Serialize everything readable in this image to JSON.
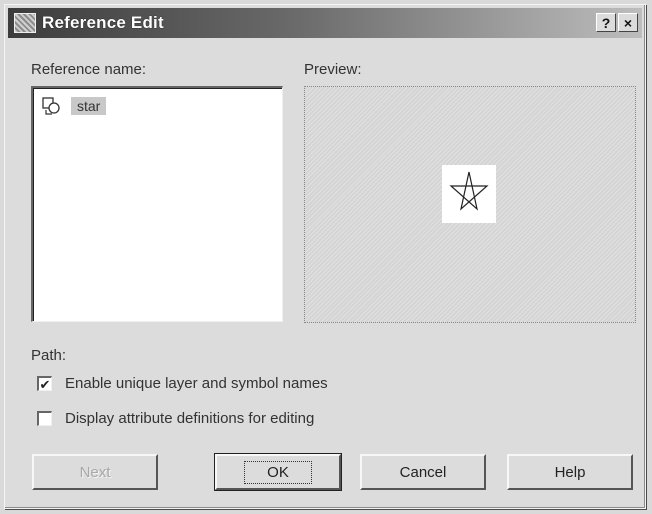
{
  "window": {
    "title": "Reference Edit",
    "help_button": "?",
    "close_button": "×"
  },
  "reference_name": {
    "label": "Reference name:",
    "items": [
      {
        "label": "star",
        "icon": "block-reference-icon",
        "selected": true
      }
    ]
  },
  "preview": {
    "label": "Preview:",
    "shape": "star"
  },
  "path": {
    "label": "Path:"
  },
  "options": [
    {
      "label": "Enable unique layer and symbol names",
      "checked": true
    },
    {
      "label": "Display attribute definitions for editing",
      "checked": false
    }
  ],
  "buttons": {
    "next": "Next",
    "ok": "OK",
    "cancel": "Cancel",
    "help": "Help"
  }
}
